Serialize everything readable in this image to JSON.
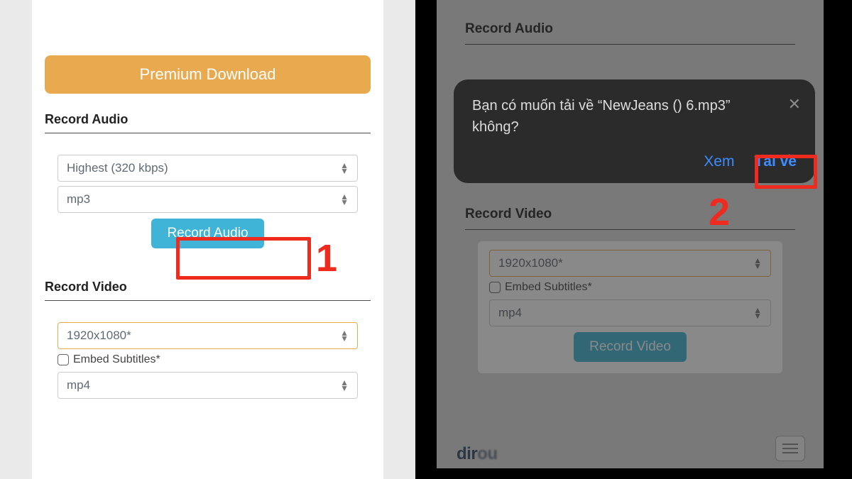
{
  "left": {
    "premium_label": "Premium Download",
    "audio": {
      "title": "Record Audio",
      "quality": "Highest (320 kbps)",
      "format": "mp3",
      "record_label": "Record Audio"
    },
    "video": {
      "title": "Record Video",
      "resolution": "1920x1080*",
      "subtitles_label": "Embed Subtitles*",
      "format": "mp4"
    },
    "annotation_1": "1"
  },
  "right": {
    "bg": {
      "audio_title": "Record Audio",
      "video_title": "Record Video",
      "resolution": "1920x1080*",
      "subtitles_label": "Embed Subtitles*",
      "format": "mp4",
      "record_label": "Record Video",
      "brand": "dir"
    },
    "modal": {
      "message": "Bạn có muốn tải về “NewJeans () 6.mp3” không?",
      "view_label": "Xem",
      "download_label": "Tải về"
    },
    "annotation_2": "2"
  }
}
